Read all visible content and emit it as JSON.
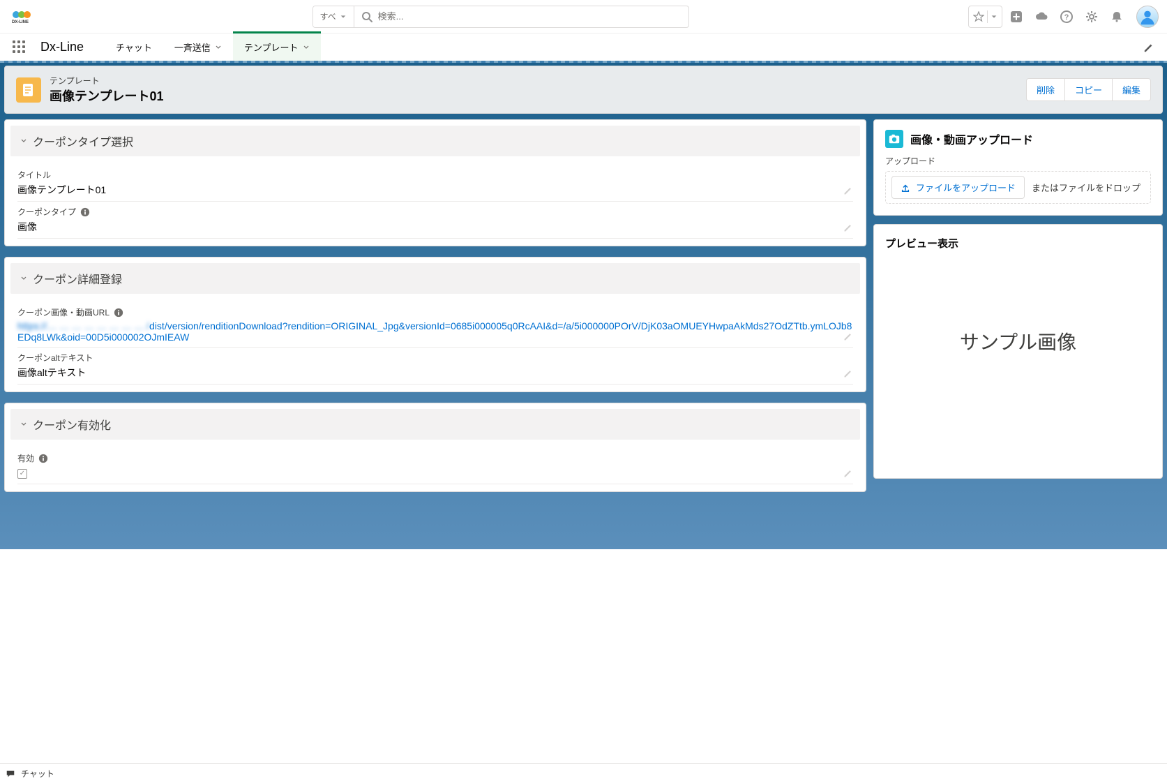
{
  "header": {
    "logo_text": "DX-LINE",
    "search_scope": "すべ",
    "search_placeholder": "検索..."
  },
  "nav": {
    "app_name": "Dx-Line",
    "tabs": [
      {
        "label": "チャット",
        "has_dd": false,
        "active": false
      },
      {
        "label": "一斉送信",
        "has_dd": true,
        "active": false
      },
      {
        "label": "テンプレート",
        "has_dd": true,
        "active": true
      }
    ]
  },
  "page_header": {
    "object_label": "テンプレート",
    "title": "画像テンプレート01",
    "actions": {
      "delete": "削除",
      "copy": "コピー",
      "edit": "編集"
    }
  },
  "sections": {
    "s1": {
      "title": "クーポンタイプ選択",
      "fields": {
        "title": {
          "label": "タイトル",
          "value": "画像テンプレート01"
        },
        "coupon_type": {
          "label": "クーポンタイプ",
          "value": "画像"
        }
      }
    },
    "s2": {
      "title": "クーポン詳細登録",
      "fields": {
        "url": {
          "label": "クーポン画像・動画URL",
          "value_link_masked": "https://… … … … … … … … /",
          "value_link_rest": "dist/version/renditionDownload?rendition=ORIGINAL_Jpg&versionId=0685i000005q0RcAAI&d=/a/5i000000POrV/DjK03aOMUEYHwpaAkMds27OdZTtb.ymLOJb8EDq8LWk&oid=00D5i000002OJmIEAW"
        },
        "alt": {
          "label": "クーポンaltテキスト",
          "value": "画像altテキスト"
        }
      }
    },
    "s3": {
      "title": "クーポン有効化",
      "fields": {
        "enabled": {
          "label": "有効",
          "checked": true
        }
      }
    }
  },
  "right": {
    "upload_title": "画像・動画アップロード",
    "upload_label": "アップロード",
    "upload_button": "ファイルをアップロード",
    "drop_text": "またはファイルをドロップ",
    "preview_title": "プレビュー表示",
    "preview_placeholder": "サンプル画像"
  },
  "utility": {
    "chat": "チャット"
  }
}
